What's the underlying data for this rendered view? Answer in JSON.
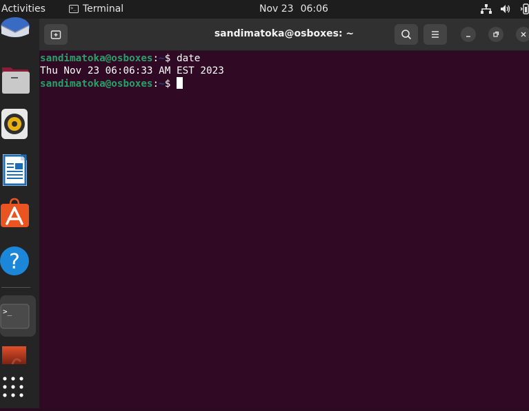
{
  "topbar": {
    "activities_label": "Activities",
    "app_name": "Terminal",
    "date": "Nov 23",
    "time": "06:06",
    "icons": [
      "network-icon",
      "volume-icon",
      "battery-icon"
    ]
  },
  "dock": {
    "items": [
      {
        "name": "thunderbird-icon"
      },
      {
        "name": "files-icon"
      },
      {
        "name": "rhythmbox-icon"
      },
      {
        "name": "libreoffice-writer-icon"
      },
      {
        "name": "app-center-icon"
      },
      {
        "name": "help-icon"
      },
      {
        "name": "terminal-icon",
        "active": true
      },
      {
        "name": "partial-app-icon"
      },
      {
        "name": "show-apps-icon"
      }
    ]
  },
  "window": {
    "title": "sandimatoka@osboxes: ~",
    "buttons": [
      "new-tab-icon",
      "search-icon",
      "menu-icon",
      "minimize-icon",
      "maximize-icon",
      "close-icon"
    ]
  },
  "terminal": {
    "prompt_user": "sandimatoka@osboxes",
    "prompt_sep": ":",
    "prompt_path": "~",
    "prompt_symbol": "$",
    "command": " date",
    "output": "Thu Nov 23 06:06:33 AM EST 2023"
  },
  "colors": {
    "terminal_bg": "#300a24",
    "prompt_user": "#26a269",
    "prompt_path": "#12488b",
    "topbar_bg": "#1d1d1d",
    "dock_bg": "#242424",
    "headerbar_bg": "#303030"
  }
}
